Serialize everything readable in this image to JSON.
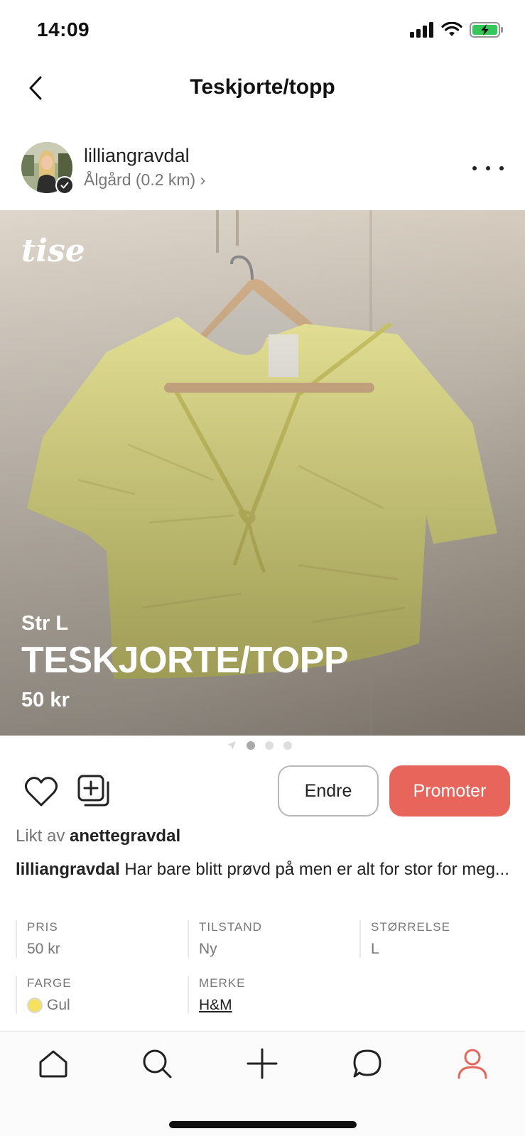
{
  "status_bar": {
    "time": "14:09",
    "icons": [
      "signal-icon",
      "wifi-icon",
      "battery-charging-icon"
    ]
  },
  "header": {
    "title": "Teskjorte/topp",
    "back_icon": "chevron-left-icon"
  },
  "seller": {
    "username": "lilliangravdal",
    "location": "Ålgård (0.2 km) ›",
    "verified_icon": "check-icon",
    "more_icon": "more-horizontal-icon"
  },
  "listing": {
    "watermark": "tise",
    "size_label": "Str L",
    "title": "TESKJORTE/TOPP",
    "price": "50 kr",
    "image_count": 3,
    "active_image": 1
  },
  "actions": {
    "like_icon": "heart-icon",
    "collect_icon": "add-collection-icon",
    "edit_label": "Endre",
    "promote_label": "Promoter",
    "accent_color": "#e8655b"
  },
  "likes": {
    "prefix": "Likt av",
    "user": "anettegravdal"
  },
  "description": {
    "author": "lilliangravdal",
    "text": " Har bare blitt prøvd på men er alt for stor for meg..."
  },
  "details": {
    "price_label": "PRIS",
    "price_value": "50 kr",
    "condition_label": "TILSTAND",
    "condition_value": "Ny",
    "size_label": "STØRRELSE",
    "size_value": "L",
    "color_label": "FARGE",
    "color_value": "Gul",
    "color_swatch": "#f6e15e",
    "brand_label": "MERKE",
    "brand_value": "H&M"
  },
  "tabbar": {
    "items": [
      "home-icon",
      "search-icon",
      "plus-icon",
      "chat-icon",
      "profile-icon"
    ],
    "active": "profile-icon",
    "active_color": "#e8655b"
  }
}
